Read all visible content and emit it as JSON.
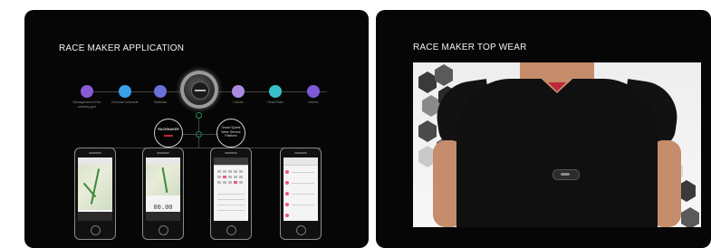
{
  "left_panel": {
    "title": "RACE MAKER APPLICATION",
    "features": [
      {
        "label": "Management of the wearing gym",
        "color": "#8a5bd6",
        "icon": "sync-icon"
      },
      {
        "label": "Exercise schedule",
        "color": "#3aa0e8",
        "icon": "calendar-icon"
      },
      {
        "label": "Statistics",
        "color": "#6b6fd9",
        "icon": "stats-icon"
      },
      {
        "label": "Calorie",
        "color": "#a98ce0",
        "icon": "drop-icon"
      },
      {
        "label": "Heart Rate",
        "color": "#38c1c9",
        "icon": "heart-icon"
      },
      {
        "label": "Interim",
        "color": "#7e5bd6",
        "icon": "runner-icon"
      }
    ],
    "device_circle_text": "RACEMAKER",
    "info_circle_text": "Smart Sports Wear Service Platform",
    "phone_readout": "00.00"
  },
  "right_panel": {
    "title": "RACE MAKER TOP WEAR"
  },
  "colors": {
    "panel_bg": "#060606",
    "accent_green": "#2c8a55",
    "accent_red": "#c0283a"
  }
}
